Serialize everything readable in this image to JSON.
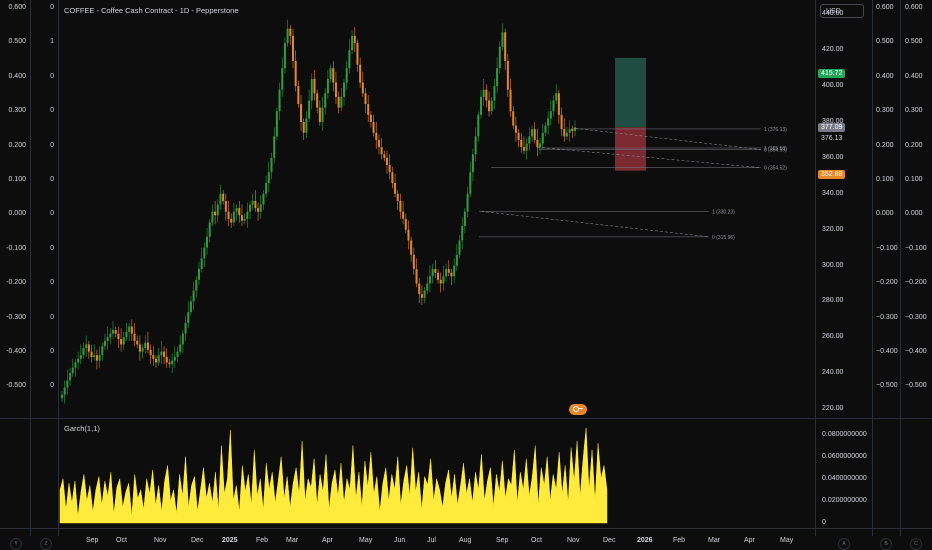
{
  "title": "COFFEE - Coffee Cash Contract - 1D - Pepperstone",
  "currency": "USD",
  "indicator_label": "Garch(1,1)",
  "left_axis_outer": [
    "0.600",
    "0.500",
    "0.400",
    "0.300",
    "0.200",
    "0.100",
    "0.000",
    "-0.100",
    "-0.200",
    "-0.300",
    "-0.400",
    "-0.500"
  ],
  "left_axis_inner": [
    "0",
    "1",
    "0",
    "0",
    "0",
    "0",
    "0",
    "0",
    "0",
    "0",
    "0",
    "0"
  ],
  "right_axis_outer": [
    "0.600",
    "0.500",
    "0.400",
    "0.300",
    "0.200",
    "0.100",
    "0.000",
    "−0.100",
    "−0.200",
    "−0.300",
    "−0.400",
    "−0.500"
  ],
  "right_axis_mid": [
    "0.600",
    "0.500",
    "0.400",
    "0.300",
    "0.200",
    "0.100",
    "0.000",
    "−0.100",
    "−0.200",
    "−0.300",
    "−0.400",
    "−0.500"
  ],
  "price_axis": [
    "440.00",
    "420.00",
    "400.00",
    "380.00",
    "360.00",
    "340.00",
    "320.00",
    "300.00",
    "280.00",
    "260.00",
    "240.00",
    "220.00"
  ],
  "price_labels": {
    "target": "415.72",
    "current": "377.09",
    "last": "376.13",
    "stop": "352.88"
  },
  "fib_labels": [
    "1 (376.13)",
    "1 (365.50)",
    "0 (364.59)",
    "0 (354.52)",
    "1 (330.23)",
    "0 (315.96)"
  ],
  "garch_axis": [
    "0.0800000000",
    "0.0600000000",
    "0.0400000000",
    "0.0200000000",
    "0"
  ],
  "x_labels": [
    "Sep",
    "Oct",
    "Nov",
    "Dec",
    "2025",
    "Feb",
    "Mar",
    "Apr",
    "May",
    "Jun",
    "Jul",
    "Aug",
    "Sep",
    "Oct",
    "Nov",
    "Dec",
    "2026",
    "Feb",
    "Mar",
    "Apr",
    "May"
  ],
  "corner_buttons": [
    "Y",
    "Z",
    "A",
    "B",
    "C"
  ],
  "colors": {
    "up": "#2e9e3f",
    "down": "#e8862a",
    "garch": "#ffeb3b",
    "target_zone": "#1f4d42",
    "stop_zone": "#7a2a30"
  },
  "chart_data": [
    {
      "type": "candlestick",
      "title": "COFFEE - Coffee Cash Contract - 1D - Pepperstone",
      "ylabel": "USD",
      "ylim": [
        215,
        448
      ],
      "x": [
        "Sep",
        "Oct",
        "Nov",
        "Dec",
        "2025",
        "Feb",
        "Mar",
        "Apr",
        "May",
        "Jun",
        "Jul",
        "Aug",
        "Sep",
        "Oct",
        "Nov",
        "Dec",
        "2026",
        "Feb",
        "Mar",
        "Apr",
        "May"
      ],
      "series": [
        {
          "closes": [
            228,
            232,
            236,
            240,
            243,
            246,
            248,
            250,
            254,
            256,
            252,
            249,
            250,
            247,
            250,
            255,
            258,
            260,
            262,
            264,
            262,
            259,
            256,
            260,
            263,
            266,
            262,
            258,
            256,
            252,
            254,
            257,
            253,
            250,
            248,
            246,
            250,
            252,
            249,
            246,
            245,
            247,
            249,
            252,
            256,
            262,
            268,
            274,
            280,
            286,
            292,
            298,
            304,
            310,
            316,
            324,
            330,
            328,
            334,
            340,
            336,
            330,
            326,
            324,
            330,
            332,
            328,
            325,
            326,
            330,
            334,
            336,
            332,
            330,
            334,
            340,
            346,
            352,
            360,
            372,
            386,
            398,
            410,
            424,
            432,
            428,
            414,
            400,
            390,
            380,
            374,
            382,
            392,
            404,
            396,
            388,
            380,
            388,
            396,
            404,
            410,
            402,
            394,
            388,
            394,
            402,
            410,
            420,
            428,
            424,
            412,
            402,
            396,
            390,
            384,
            380,
            374,
            370,
            366,
            362,
            360,
            356,
            352,
            346,
            340,
            336,
            330,
            326,
            320,
            314,
            306,
            298,
            290,
            284,
            282,
            286,
            290,
            294,
            298,
            296,
            292,
            290,
            294,
            298,
            296,
            294,
            300,
            306,
            314,
            322,
            330,
            340,
            352,
            362,
            372,
            384,
            394,
            398,
            392,
            386,
            392,
            400,
            410,
            422,
            430,
            414,
            398,
            386,
            378,
            374,
            370,
            366,
            364,
            368,
            372,
            376,
            370,
            366,
            368,
            374,
            378,
            382,
            386,
            392,
            396,
            384,
            376,
            372,
            374,
            376,
            375,
            377
          ]
        }
      ],
      "annotations": {
        "long_position_target": 415.72,
        "long_position_stop": 352.88,
        "entry": 377.09,
        "last": 376.13,
        "fib_levels": [
          376.13,
          365.5,
          364.59,
          354.52,
          330.23,
          315.96
        ]
      }
    },
    {
      "type": "area",
      "title": "Garch(1,1)",
      "ylim": [
        0,
        0.085
      ],
      "series": [
        {
          "name": "Garch(1,1)",
          "values": [
            0.03,
            0.04,
            0.012,
            0.036,
            0.018,
            0.038,
            0.006,
            0.028,
            0.044,
            0.02,
            0.034,
            0.01,
            0.03,
            0.042,
            0.016,
            0.038,
            0.024,
            0.046,
            0.008,
            0.032,
            0.04,
            0.014,
            0.028,
            0.036,
            0.006,
            0.044,
            0.022,
            0.03,
            0.012,
            0.04,
            0.026,
            0.048,
            0.016,
            0.034,
            0.01,
            0.038,
            0.052,
            0.02,
            0.03,
            0.008,
            0.044,
            0.024,
            0.06,
            0.014,
            0.034,
            0.042,
            0.01,
            0.03,
            0.05,
            0.022,
            0.036,
            0.018,
            0.046,
            0.012,
            0.07,
            0.026,
            0.04,
            0.084,
            0.02,
            0.034,
            0.01,
            0.052,
            0.028,
            0.044,
            0.016,
            0.066,
            0.024,
            0.04,
            0.012,
            0.054,
            0.03,
            0.046,
            0.018,
            0.038,
            0.06,
            0.022,
            0.042,
            0.014,
            0.036,
            0.05,
            0.026,
            0.074,
            0.02,
            0.04,
            0.032,
            0.058,
            0.016,
            0.044,
            0.028,
            0.062,
            0.012,
            0.036,
            0.048,
            0.024,
            0.054,
            0.018,
            0.04,
            0.03,
            0.07,
            0.022,
            0.046,
            0.014,
            0.056,
            0.032,
            0.064,
            0.026,
            0.042,
            0.01,
            0.036,
            0.05,
            0.02,
            0.044,
            0.03,
            0.06,
            0.016,
            0.038,
            0.052,
            0.024,
            0.068,
            0.028,
            0.046,
            0.012,
            0.042,
            0.034,
            0.058,
            0.02,
            0.04,
            0.03,
            0.014,
            0.036,
            0.048,
            0.022,
            0.044,
            0.016,
            0.034,
            0.054,
            0.026,
            0.04,
            0.018,
            0.046,
            0.03,
            0.062,
            0.02,
            0.038,
            0.05,
            0.014,
            0.044,
            0.028,
            0.056,
            0.022,
            0.04,
            0.034,
            0.066,
            0.018,
            0.046,
            0.03,
            0.058,
            0.024,
            0.042,
            0.07,
            0.016,
            0.05,
            0.034,
            0.06,
            0.02,
            0.044,
            0.03,
            0.064,
            0.026,
            0.052,
            0.018,
            0.068,
            0.038,
            0.074,
            0.024,
            0.058,
            0.086,
            0.03,
            0.066,
            0.02,
            0.072,
            0.04,
            0.052,
            0.03
          ]
        }
      ]
    }
  ]
}
